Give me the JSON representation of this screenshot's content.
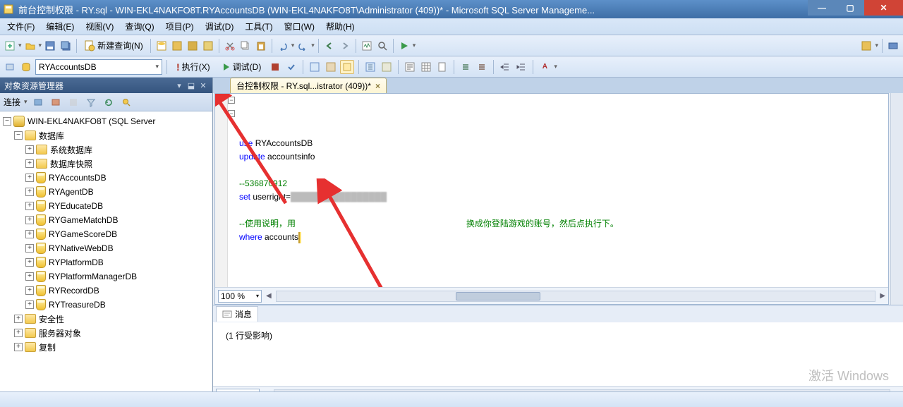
{
  "title": "前台控制权限 - RY.sql - WIN-EKL4NAKFO8T.RYAccountsDB (WIN-EKL4NAKFO8T\\Administrator (409))* - Microsoft SQL Server Manageme...",
  "menu": [
    "文件(F)",
    "编辑(E)",
    "视图(V)",
    "查询(Q)",
    "项目(P)",
    "调试(D)",
    "工具(T)",
    "窗口(W)",
    "帮助(H)"
  ],
  "toolbar": {
    "new_query": "新建查询(N)"
  },
  "toolbar2": {
    "db": "RYAccountsDB",
    "execute": "执行(X)",
    "debug": "调试(D)"
  },
  "explorer": {
    "title": "对象资源管理器",
    "connect": "连接",
    "server": "WIN-EKL4NAKFO8T (SQL Server",
    "folders": {
      "databases": "数据库",
      "sysdb": "系统数据库",
      "snapshot": "数据库快照",
      "security": "安全性",
      "serverobj": "服务器对象",
      "replication": "复制"
    },
    "dbs": [
      "RYAccountsDB",
      "RYAgentDB",
      "RYEducateDB",
      "RYGameMatchDB",
      "RYGameScoreDB",
      "RYNativeWebDB",
      "RYPlatformDB",
      "RYPlatformManagerDB",
      "RYRecordDB",
      "RYTreasureDB"
    ]
  },
  "tab": {
    "label": "台控制权限 - RY.sql...istrator (409))*"
  },
  "code": {
    "l1a": "use",
    "l1b": " RYAccountsDB",
    "l2a": "update",
    "l2b": " accountsinfo",
    "l3": "--536870912",
    "l4a": "set",
    "l4b": " userright=",
    "l5a": "--使用说明，用",
    "l5b": "换成你登陆游戏的账号，然后点执行下。",
    "l6a": "where",
    "l6b": " accounts"
  },
  "zoom": "100 %",
  "messages": {
    "tab": "消息",
    "body": "(1 行受影响)"
  },
  "watermark": "激活 Windows"
}
